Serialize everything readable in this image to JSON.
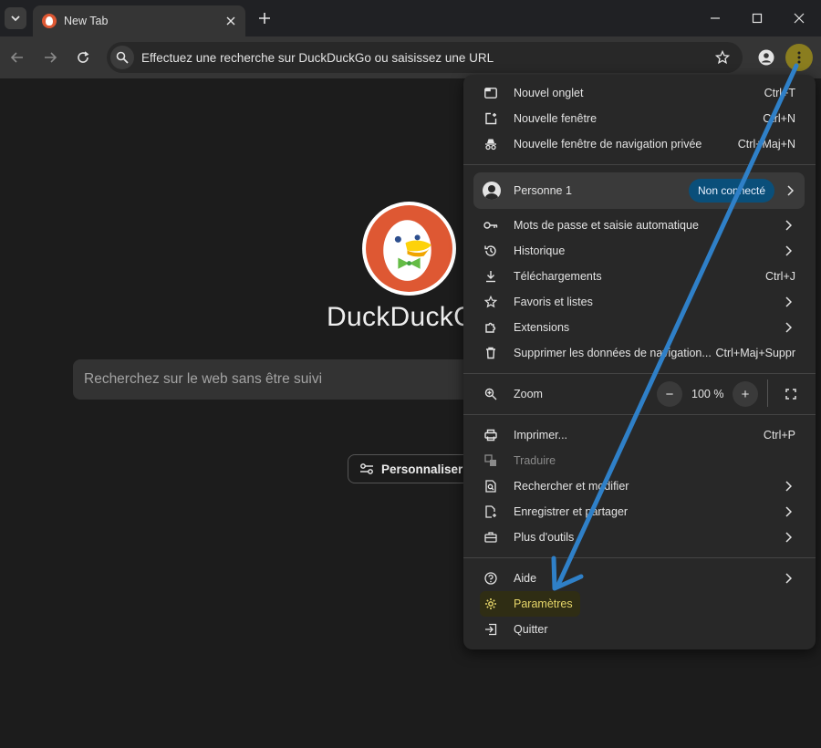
{
  "tab": {
    "title": "New Tab"
  },
  "omnibox": {
    "placeholder": "Effectuez une recherche sur DuckDuckGo ou saisissez une URL"
  },
  "page": {
    "brand": "DuckDuckGo",
    "search_placeholder": "Recherchez sur le web sans être suivi",
    "customize_label": "Personnaliser"
  },
  "menu": {
    "new_tab": {
      "label": "Nouvel onglet",
      "shortcut": "Ctrl+T"
    },
    "new_window": {
      "label": "Nouvelle fenêtre",
      "shortcut": "Ctrl+N"
    },
    "incognito": {
      "label": "Nouvelle fenêtre de navigation privée",
      "shortcut": "Ctrl+Maj+N"
    },
    "profile": {
      "name": "Personne 1",
      "status": "Non connecté"
    },
    "passwords": {
      "label": "Mots de passe et saisie automatique"
    },
    "history": {
      "label": "Historique"
    },
    "downloads": {
      "label": "Téléchargements",
      "shortcut": "Ctrl+J"
    },
    "bookmarks": {
      "label": "Favoris et listes"
    },
    "extensions": {
      "label": "Extensions"
    },
    "clear_data": {
      "label": "Supprimer les données de navigation...",
      "shortcut": "Ctrl+Maj+Suppr"
    },
    "zoom": {
      "label": "Zoom",
      "minus": "−",
      "value": "100 %",
      "plus": "+"
    },
    "print": {
      "label": "Imprimer...",
      "shortcut": "Ctrl+P"
    },
    "translate": {
      "label": "Traduire"
    },
    "find_edit": {
      "label": "Rechercher et modifier"
    },
    "save_share": {
      "label": "Enregistrer et partager"
    },
    "more_tools": {
      "label": "Plus d'outils"
    },
    "help": {
      "label": "Aide"
    },
    "settings": {
      "label": "Paramètres"
    },
    "quit": {
      "label": "Quitter"
    }
  },
  "colors": {
    "accent_arrow": "#2f80c8",
    "menu_button": "#8a7d1f",
    "settings_highlight": "#e7d76a",
    "profile_badge": "#0a4f7a",
    "duckduckgo_orange": "#de5833"
  }
}
